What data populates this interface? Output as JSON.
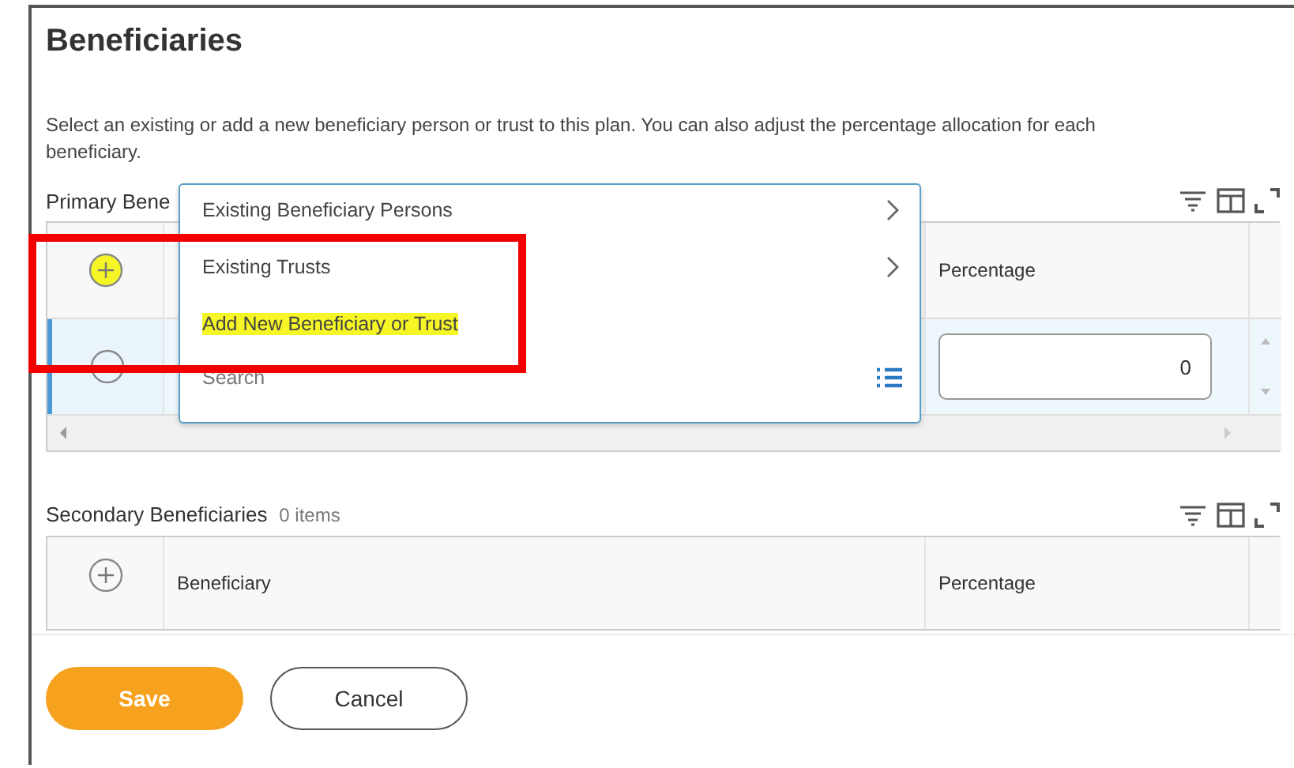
{
  "title": "Beneficiaries",
  "description": "Select an existing or add a new beneficiary person or trust to this plan. You can also adjust the percentage allocation for each beneficiary.",
  "primary": {
    "label": "Primary Bene",
    "add_highlighted": true,
    "percentage_header": "Percentage",
    "rows": [
      {
        "selected": true,
        "percentage": "0"
      }
    ]
  },
  "menu": {
    "items": [
      {
        "label": "Existing Beneficiary Persons",
        "submenu": true,
        "highlighted": false
      },
      {
        "label": "Existing Trusts",
        "submenu": true,
        "highlighted": false
      },
      {
        "label": "Add New Beneficiary or Trust",
        "submenu": false,
        "highlighted": true
      }
    ],
    "search": {
      "placeholder": "Search"
    }
  },
  "secondary": {
    "label": "Secondary Beneficiaries",
    "count": "0 items",
    "add_highlighted": false,
    "columns": [
      "Beneficiary",
      "Percentage"
    ]
  },
  "buttons": [
    {
      "label": "Save",
      "kind": "primary"
    },
    {
      "label": "Cancel",
      "kind": "secondary"
    }
  ]
}
